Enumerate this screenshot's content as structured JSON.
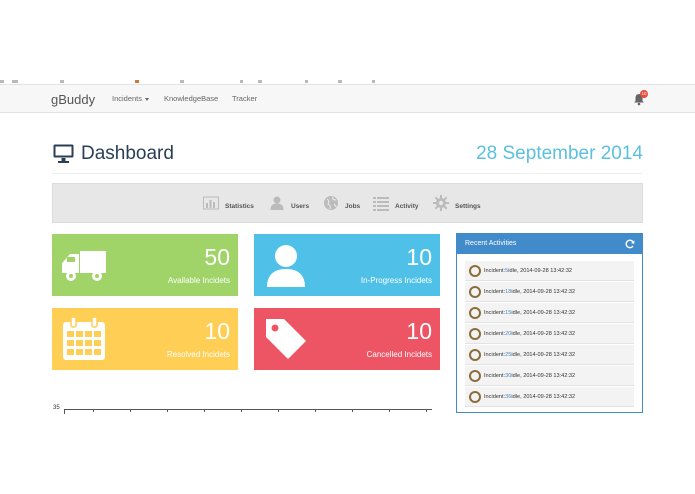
{
  "navbar": {
    "brand": "gBuddy",
    "items": [
      {
        "label": "Incidents",
        "has_caret": true
      },
      {
        "label": "KnowledgeBase"
      },
      {
        "label": "Tracker"
      }
    ],
    "notification_count": "10"
  },
  "header": {
    "title": "Dashboard",
    "date": "28 September 2014",
    "icon": "monitor-icon"
  },
  "toolbar": {
    "items": [
      {
        "label": "Statistics",
        "icon": "bar-chart-icon"
      },
      {
        "label": "Users",
        "icon": "user-icon"
      },
      {
        "label": "Jobs",
        "icon": "globe-icon"
      },
      {
        "label": "Activity",
        "icon": "list-icon"
      },
      {
        "label": "Settings",
        "icon": "gear-icon"
      }
    ]
  },
  "tiles": [
    {
      "value": "50",
      "label": "Available Incidets",
      "color": "#a0d468",
      "icon": "truck-icon"
    },
    {
      "value": "10",
      "label": "In-Progress Incidets",
      "color": "#4fc1e9",
      "icon": "user-icon"
    },
    {
      "value": "10",
      "label": "Resolved Incidets",
      "color": "#ffce54",
      "icon": "calendar-icon"
    },
    {
      "value": "10",
      "label": "Cancelled Incidets",
      "color": "#ed5565",
      "icon": "tag-icon"
    }
  ],
  "recent": {
    "title": "Recent Activities",
    "items": [
      {
        "prefix": "Incident:",
        "id": "5",
        "text": " idle, 2014-09-28 13:42:32"
      },
      {
        "prefix": "Incident:",
        "id": "18",
        "text": " idle, 2014-09-28 13:42:32"
      },
      {
        "prefix": "Incident:",
        "id": "15",
        "text": " idle, 2014-09-28 13:42:32"
      },
      {
        "prefix": "Incident:",
        "id": "20",
        "text": " idle, 2014-09-28 13:42:32"
      },
      {
        "prefix": "Incident:",
        "id": "25",
        "text": " idle, 2014-09-28 13:42:32"
      },
      {
        "prefix": "Incident:",
        "id": "30",
        "text": " idle, 2014-09-28 13:42:32"
      },
      {
        "prefix": "Incident:",
        "id": "36",
        "text": " idle, 2014-09-28 13:42:32"
      }
    ]
  },
  "chart": {
    "y_top_label": "35"
  }
}
